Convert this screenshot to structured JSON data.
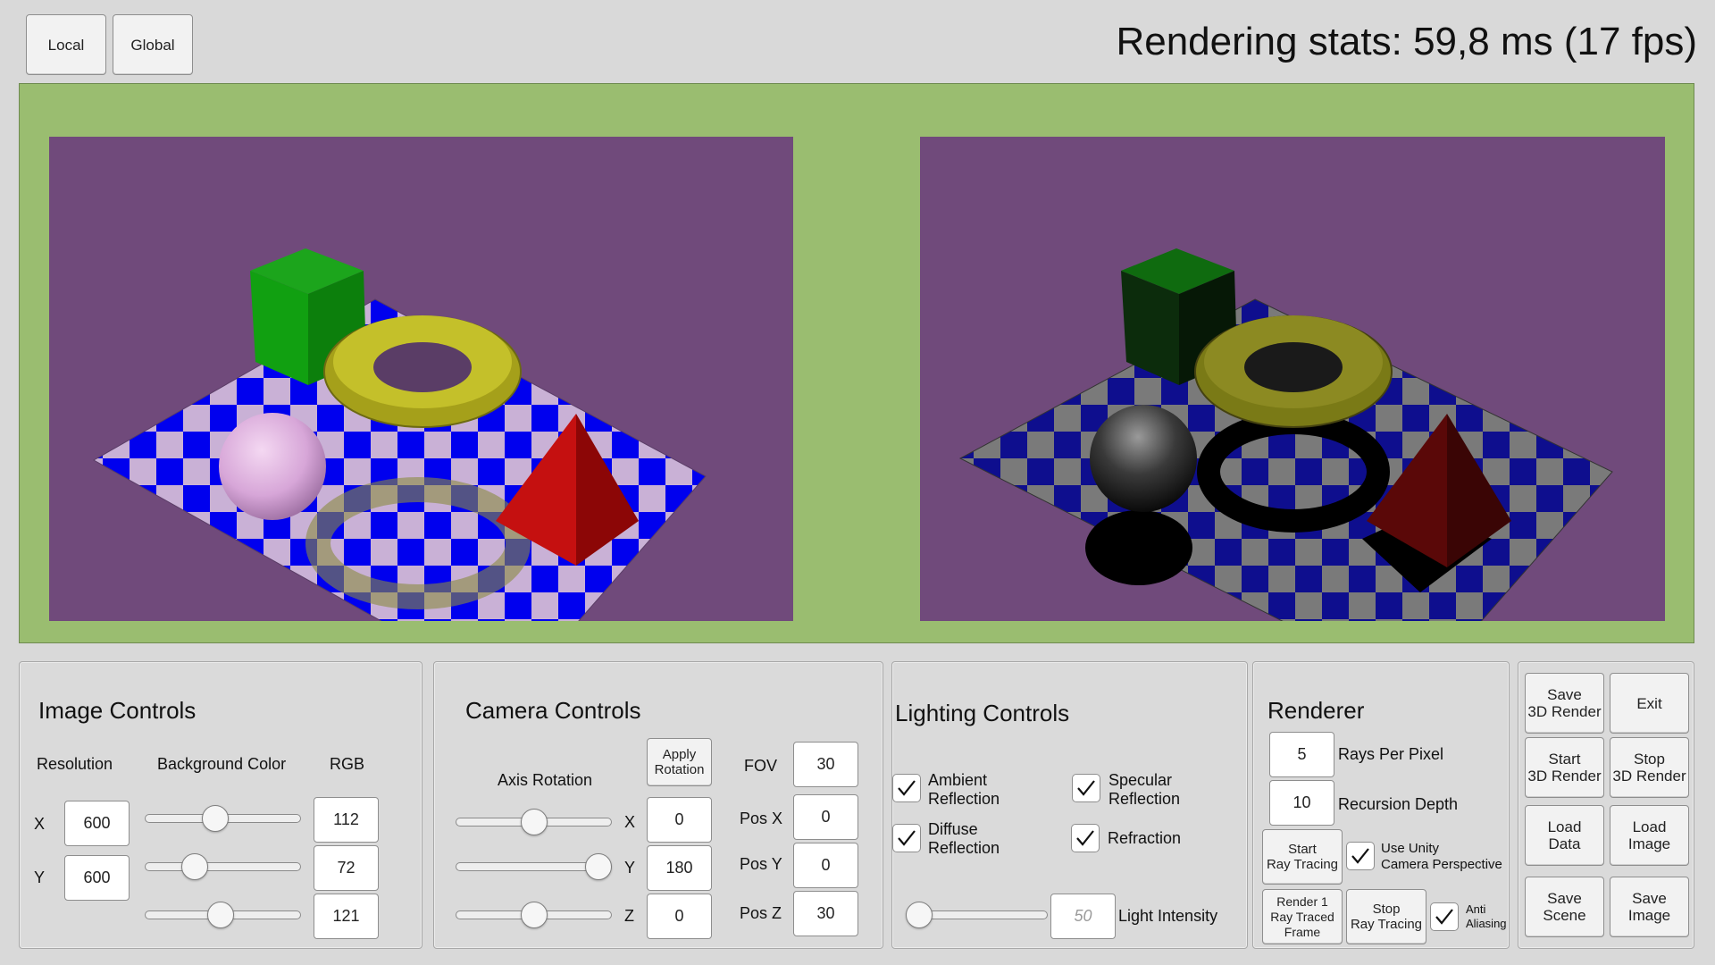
{
  "header": {
    "local_label": "Local",
    "global_label": "Global",
    "stats_text": "Rendering stats: 59,8 ms (17 fps)"
  },
  "colors": {
    "viewport_frame": "#9abd70",
    "scene_background": "#704a7b",
    "checker_blue": "#0000ee",
    "checker_light": "#c9b1d6"
  },
  "image_controls": {
    "title": "Image Controls",
    "resolution_label": "Resolution",
    "bg_color_label": "Background Color",
    "rgb_label": "RGB",
    "x_label": "X",
    "y_label": "Y",
    "res_x": "600",
    "res_y": "600",
    "r": "112",
    "g": "72",
    "b": "121"
  },
  "camera_controls": {
    "title": "Camera Controls",
    "axis_rotation_label": "Axis Rotation",
    "apply_rotation_label": "Apply\nRotation",
    "x_label": "X",
    "y_label": "Y",
    "z_label": "Z",
    "rot_x": "0",
    "rot_y": "180",
    "rot_z": "0",
    "fov_label": "FOV",
    "fov": "30",
    "pos_x_label": "Pos X",
    "pos_y_label": "Pos Y",
    "pos_z_label": "Pos Z",
    "pos_x": "0",
    "pos_y": "0",
    "pos_z": "30"
  },
  "lighting_controls": {
    "title": "Lighting Controls",
    "ambient_label": "Ambient\nReflection",
    "specular_label": "Specular\nReflection",
    "diffuse_label": "Diffuse\nReflection",
    "refraction_label": "Refraction",
    "ambient_checked": true,
    "specular_checked": true,
    "diffuse_checked": true,
    "refraction_checked": true,
    "light_intensity_placeholder": "50",
    "light_intensity_label": "Light Intensity"
  },
  "renderer": {
    "title": "Renderer",
    "rays_per_pixel": "5",
    "rays_per_pixel_label": "Rays Per Pixel",
    "recursion_depth": "10",
    "recursion_depth_label": "Recursion Depth",
    "start_ray_tracing_label": "Start\nRay Tracing",
    "use_unity_label": "Use Unity\nCamera Perspective",
    "use_unity_checked": true,
    "render_one_label": "Render 1\nRay Traced\nFrame",
    "stop_ray_tracing_label": "Stop\nRay Tracing",
    "anti_aliasing_label": "Anti\nAliasing",
    "anti_aliasing_checked": true
  },
  "actions": {
    "save_3d_render": "Save\n3D Render",
    "exit": "Exit",
    "start_3d_render": "Start\n3D Render",
    "stop_3d_render": "Stop\n3D Render",
    "load_data": "Load\nData",
    "load_image": "Load\nImage",
    "save_scene": "Save\nScene",
    "save_image": "Save\nImage"
  },
  "slider_levels": {
    "bg_r": 0.44,
    "bg_g": 0.28,
    "bg_b": 0.48,
    "rot_x": 0.5,
    "rot_y": 1.0,
    "rot_z": 0.5,
    "light_intensity": 0.0
  }
}
